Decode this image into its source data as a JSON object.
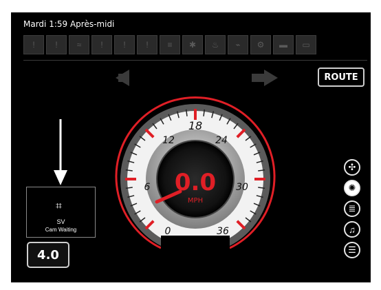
{
  "status": {
    "clock": "Mardi 1:59 Après-midi"
  },
  "warning_icons": [
    "!",
    "!",
    "≈",
    "!",
    "!",
    "!",
    "≡",
    "✱",
    "♨",
    "⌁",
    "⚙",
    "▬",
    "▭"
  ],
  "route": {
    "label": "ROUTE"
  },
  "gauge": {
    "speed": "0.0",
    "unit": "MPH",
    "ticks": [
      "0",
      "6",
      "12",
      "18",
      "24",
      "30",
      "36"
    ]
  },
  "camera": {
    "icon": "camera-icon",
    "label": "SV",
    "status": "Cam Waiting"
  },
  "display_value": "4.0",
  "side_buttons": [
    {
      "name": "fan-icon",
      "glyph": "✣"
    },
    {
      "name": "sun-icon",
      "glyph": "✺"
    },
    {
      "name": "headlight-icon",
      "glyph": "≣"
    },
    {
      "name": "music-icon",
      "glyph": "♫"
    },
    {
      "name": "menu-icon",
      "glyph": "☰"
    }
  ],
  "colors": {
    "accent": "#e01f26",
    "background": "#000000",
    "dial_face": "#f2f2f2"
  }
}
